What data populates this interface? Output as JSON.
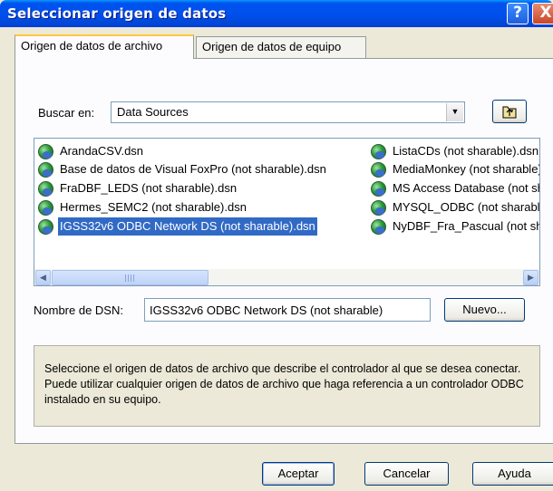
{
  "window": {
    "title": "Seleccionar origen de datos",
    "help_glyph": "?",
    "close_glyph": "X"
  },
  "tabs": [
    {
      "label": "Origen de datos de archivo",
      "active": true
    },
    {
      "label": "Origen de datos de equipo",
      "active": false
    }
  ],
  "lookin": {
    "label": "Buscar en:",
    "value": "Data Sources",
    "arrow_icon": "chevron-down-icon",
    "up_icon": "folder-up-icon"
  },
  "files": {
    "col1": [
      {
        "name": "ArandaCSV.dsn",
        "selected": false
      },
      {
        "name": "Base de datos de Visual FoxPro (not sharable).dsn",
        "selected": false
      },
      {
        "name": "FraDBF_LEDS (not sharable).dsn",
        "selected": false
      },
      {
        "name": "Hermes_SEMC2 (not sharable).dsn",
        "selected": false
      },
      {
        "name": "IGSS32v6 ODBC Network DS (not sharable).dsn",
        "selected": true
      }
    ],
    "col2": [
      {
        "name": "ListaCDs (not sharable).dsn",
        "selected": false
      },
      {
        "name": "MediaMonkey (not sharable).dsn",
        "selected": false
      },
      {
        "name": "MS Access Database (not sharable).dsn",
        "selected": false
      },
      {
        "name": "MYSQL_ODBC (not sharable).dsn",
        "selected": false
      },
      {
        "name": "NyDBF_Fra_Pascual (not sharable).dsn",
        "selected": false
      }
    ]
  },
  "dsn": {
    "label": "Nombre de DSN:",
    "value": "IGSS32v6 ODBC Network DS (not sharable)",
    "new_button": "Nuevo..."
  },
  "info_text": "Seleccione el origen de datos de archivo que describe el controlador al que se desea conectar. Puede utilizar cualquier origen de datos de archivo que haga referencia a un controlador ODBC instalado en su equipo.",
  "buttons": {
    "ok": "Aceptar",
    "cancel": "Cancelar",
    "help": "Ayuda"
  },
  "colors": {
    "title_blue": "#0053EE",
    "selection": "#316AC5",
    "dialog_bg": "#ECE9D8"
  }
}
